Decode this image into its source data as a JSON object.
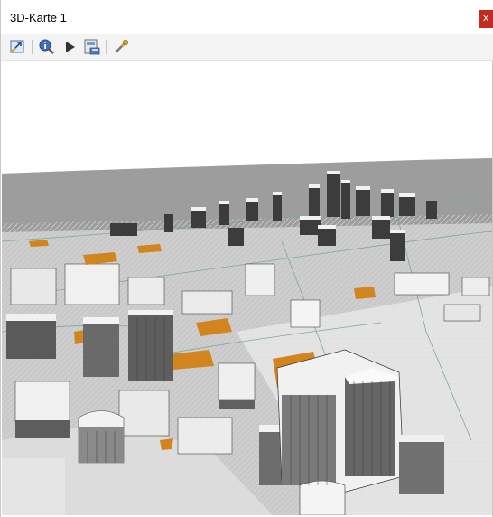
{
  "window": {
    "title": "3D-Karte 1",
    "close_glyph": "x"
  },
  "toolbar": {
    "buttons": [
      {
        "icon": "zoom-full-icon",
        "action": "zoom-full"
      },
      {
        "icon": "identify-icon",
        "action": "identify"
      },
      {
        "icon": "play-animation-icon",
        "action": "animation"
      },
      {
        "icon": "save-image-icon",
        "action": "save-as-image"
      },
      {
        "icon": "configure-icon",
        "action": "configure"
      }
    ]
  },
  "colors": {
    "terrain": "#c9c9c9",
    "building_light": "#f2f2f2",
    "building_dark": "#5a5a5a",
    "highlight": "#d2841f",
    "sky": "#ffffff",
    "close": "#c42b1c"
  }
}
